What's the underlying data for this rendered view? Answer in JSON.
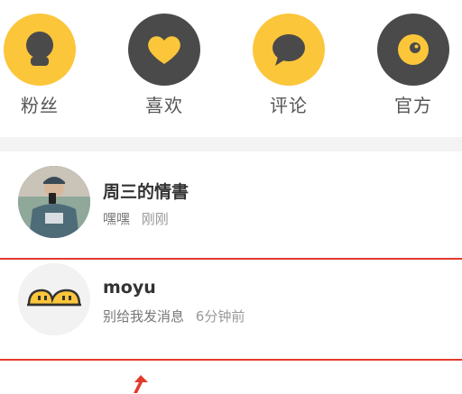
{
  "categories": [
    {
      "label": "粉丝",
      "icon": "fans-icon",
      "color": "#fcc63b"
    },
    {
      "label": "喜欢",
      "icon": "heart-icon",
      "color": "#4a4a4a"
    },
    {
      "label": "评论",
      "icon": "comment-icon",
      "color": "#fcc63b"
    },
    {
      "label": "官方",
      "icon": "official-icon",
      "color": "#4a4a4a"
    }
  ],
  "messages": [
    {
      "name": "周三的情書",
      "preview": "嘿嘿",
      "time": "刚刚",
      "avatar": "user-photo"
    },
    {
      "name": "moyu",
      "preview": "别给我发消息",
      "time": "6分钟前",
      "avatar": "moyu-mascot-icon"
    }
  ],
  "colors": {
    "accent": "#fcc63b",
    "dark": "#4a4a4a",
    "highlight": "#e23b2e"
  }
}
